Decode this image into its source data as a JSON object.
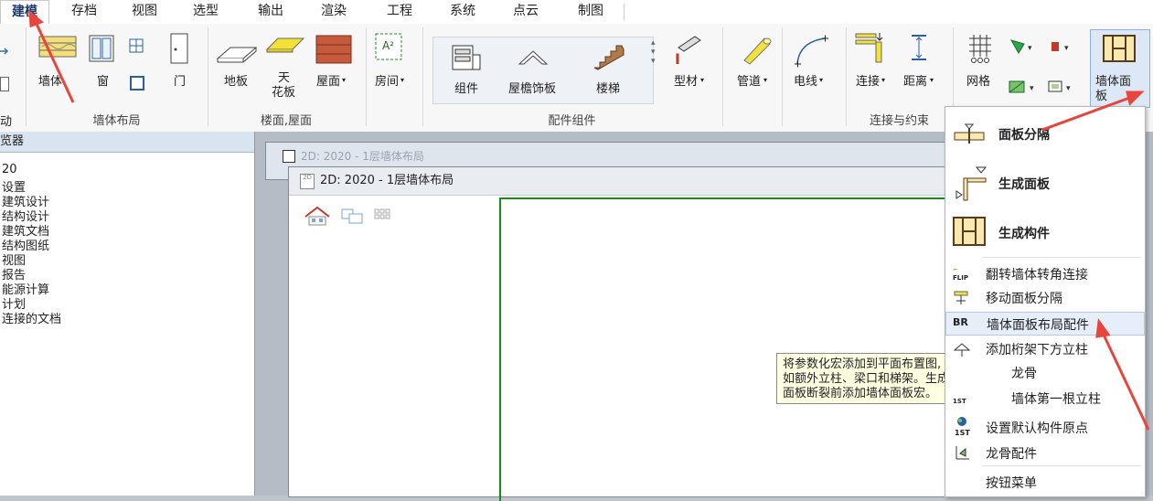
{
  "menu": {
    "items": [
      "建模",
      "存档",
      "视图",
      "选型",
      "输出",
      "渲染",
      "工程",
      "系统",
      "点云",
      "制图"
    ],
    "active": "建模"
  },
  "ribbon": {
    "wall_group": {
      "buttons": {
        "wall": "墙体",
        "window": "窗",
        "door": "门"
      },
      "label": "墙体布局"
    },
    "floor_group": {
      "buttons": {
        "floor": "地板",
        "ceiling_line1": "天",
        "ceiling_line2": "花板",
        "roof": "屋面"
      },
      "label": "楼面,屋面"
    },
    "room": {
      "label": "房间"
    },
    "component_group": {
      "buttons": {
        "component": "组件",
        "eave_trim": "屋檐饰板",
        "stairs": "楼梯",
        "profile": "型材"
      },
      "label": "配件组件"
    },
    "pipe": {
      "label": "管道"
    },
    "wire": {
      "label": "电线"
    },
    "connect_group": {
      "buttons": {
        "connect": "连接",
        "distance": "距离"
      },
      "label": "连接与约束"
    },
    "grid": {
      "label": "网格"
    },
    "wall_panel": {
      "label_line1": "墙体面",
      "label_line2": "板"
    },
    "left_cut": {
      "top": "动"
    }
  },
  "browser": {
    "title": "览器",
    "items": [
      "20",
      "设置",
      "建筑设计",
      "结构设计",
      "建筑文档",
      "结构图纸",
      "视图",
      "报告",
      "能源计算",
      "计划",
      "连接的文档"
    ]
  },
  "windows": {
    "back_title": "2D: 2020 - 1层墙体布局",
    "front_title": "2D: 2020 - 1层墙体布局"
  },
  "dropdown": {
    "items": [
      {
        "label": "面板分隔",
        "icon": "panel-divide-icon"
      },
      {
        "label": "生成面板",
        "icon": "generate-panel-icon"
      },
      {
        "label": "生成构件",
        "icon": "generate-member-icon"
      },
      {
        "label": "翻转墙体转角连接",
        "icon": "flip-icon",
        "icon_text": "FLIP"
      },
      {
        "label": "移动面板分隔",
        "icon": "move-divide-icon"
      },
      {
        "label": "墙体面板布局配件",
        "icon": "br-icon",
        "icon_text": "BR"
      },
      {
        "label": "添加桁架下方立柱",
        "icon": "truss-post-icon"
      },
      {
        "label": "龙骨",
        "icon": "stud-icon"
      },
      {
        "label": "墙体第一根立柱",
        "icon": "first-stud-icon",
        "icon_text": "1ST"
      },
      {
        "label": "设置默认构件原点",
        "icon": "set-origin-icon",
        "icon_text": "1ST"
      },
      {
        "label": "龙骨配件",
        "icon": "stud-fitting-icon"
      },
      {
        "label": "按钮菜单",
        "icon": ""
      }
    ]
  },
  "tooltip": {
    "text": "将参数化宏添加到平面布置图,\n如额外立柱、梁口和梯架。生成\n面板断裂前添加墙体面板宏。"
  },
  "colors": {
    "accent": "#1a3a6b",
    "arrow": "#e8453c",
    "frame_green": "#1a8a1a"
  }
}
